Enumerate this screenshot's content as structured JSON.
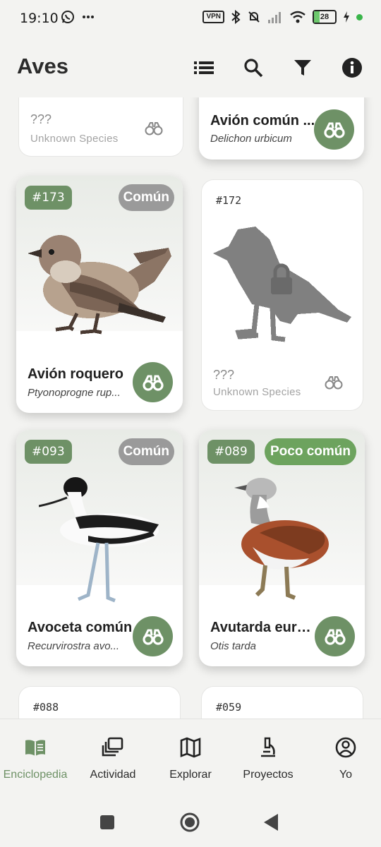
{
  "status": {
    "time": "19:10",
    "vpn": "VPN",
    "battery": "28"
  },
  "appbar": {
    "title": "Aves"
  },
  "cards": [
    {
      "unknown_label": "???",
      "unknown_sci": "Unknown Species"
    },
    {
      "name": "Avión común ...",
      "scientific": "Delichon urbicum"
    },
    {
      "number": "#173",
      "rarity": "Común",
      "name": "Avión roquero",
      "scientific": "Ptyonoprogne rup..."
    },
    {
      "number": "#172",
      "unknown_label": "???",
      "unknown_sci": "Unknown Species"
    },
    {
      "number": "#093",
      "rarity": "Común",
      "name": "Avoceta común",
      "scientific": "Recurvirostra avo..."
    },
    {
      "number": "#089",
      "rarity": "Poco común",
      "name": "Avutarda euro...",
      "scientific": "Otis tarda"
    },
    {
      "number": "#088"
    },
    {
      "number": "#059"
    }
  ],
  "nav": [
    {
      "label": "Enciclopedia",
      "icon": "book-icon",
      "active": true
    },
    {
      "label": "Actividad",
      "icon": "gallery-icon"
    },
    {
      "label": "Explorar",
      "icon": "map-icon"
    },
    {
      "label": "Proyectos",
      "icon": "microscope-icon"
    },
    {
      "label": "Yo",
      "icon": "profile-icon"
    }
  ],
  "colors": {
    "accent": "#6e9166",
    "rarity_common": "#9a9a9a",
    "rarity_uncommon": "#6da35e",
    "background": "#f3f3f1"
  }
}
